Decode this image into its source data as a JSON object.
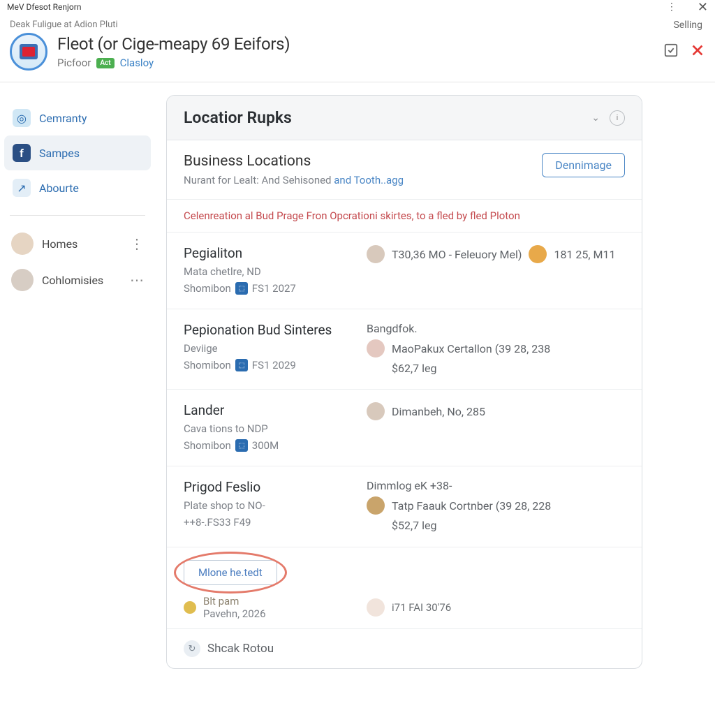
{
  "window": {
    "title": "MeV Dfesot Renjorn"
  },
  "header": {
    "breadcrumb": "Deak Fuligue at Adion Pluti",
    "selling": "Selling",
    "title": "Fleot (or Cige-meapy 69 Eeifors)",
    "sub_a": "Picfoor",
    "badge": "Act",
    "sub_b": "Clasloy"
  },
  "sidebar": {
    "items": [
      {
        "label": "Cemranty"
      },
      {
        "label": "Sampes"
      },
      {
        "label": "Abourte"
      }
    ],
    "people": [
      {
        "label": "Homes"
      },
      {
        "label": "Cohlomisies"
      }
    ]
  },
  "panel": {
    "title": "Locatior Rupks",
    "biz_title": "Business Locations",
    "biz_desc_a": "Nurant for Lealt: And Sehisoned ",
    "biz_desc_link": "and Tooth..agg",
    "den_btn": "Dennimage",
    "alert": "Celenreation al Bud Prage Fron Opcrationi skirtes, to a fled by fled Ploton",
    "locations": [
      {
        "name": "Pegialiton",
        "l2": "Mata chetlre, ND",
        "l3a": "Shomibon",
        "l3b": "FS1 2027",
        "r1": "T30,36 MO - Feleuory Mel)",
        "r1b": "181 25, M11"
      },
      {
        "name": "Pepionation Bud Sinteres",
        "l2": "Deviige",
        "l3a": "Shomibon",
        "l3b": "FS1 2029",
        "rtop": "Bangdfok.",
        "r1": "MaoPakux Certallon (39 28, 238",
        "r2": "$62,7 leg"
      },
      {
        "name": "Lander",
        "l2": "Cava tions to NDP",
        "l3a": "Shomibon",
        "l3b": "300M",
        "r1": "Dimanbeh, No, 285"
      },
      {
        "name": "Prigod Feslio",
        "l2": "Plate shop to NO-",
        "l3plain": "++8-.FS33 F49",
        "rtop": "Dimmlog eK +38-",
        "r1": "Tatp Faauk Cortnber (39 28, 228",
        "r2": "$52,7 leg"
      }
    ],
    "more_btn": "Mlone he.tedt",
    "more_meta_a": "Blt pam",
    "more_meta_b": "Pavehn, 2026",
    "more_meta_r": "i71 FAI 30'76",
    "tail": "Shcak Rotou"
  }
}
